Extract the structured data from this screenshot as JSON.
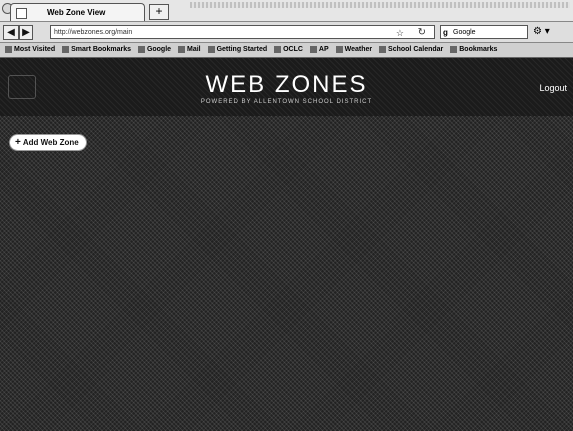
{
  "browser": {
    "tab_title": "Web Zone View",
    "new_tab_label": "+",
    "url": "http://webzones.org/main",
    "search_placeholder": "Google",
    "search_engine_glyph": "g",
    "back_label": "◀",
    "forward_label": "▶",
    "star_glyph": "☆",
    "reload_glyph": "↻",
    "tool_icons_glyph": "⚙ ▾",
    "bookmarks": [
      "Most Visited",
      "Smart Bookmarks",
      "Google",
      "Mail",
      "Getting Started",
      "OCLC",
      "AP",
      "Weather",
      "School Calendar",
      "Bookmarks"
    ]
  },
  "header": {
    "title": "WEB ZONES",
    "subtitle": "POWERED BY ALLENTOWN SCHOOL DISTRICT",
    "logout_label": "Logout"
  },
  "main": {
    "add_button_label": "Add Web Zone",
    "add_button_icon": "+"
  }
}
